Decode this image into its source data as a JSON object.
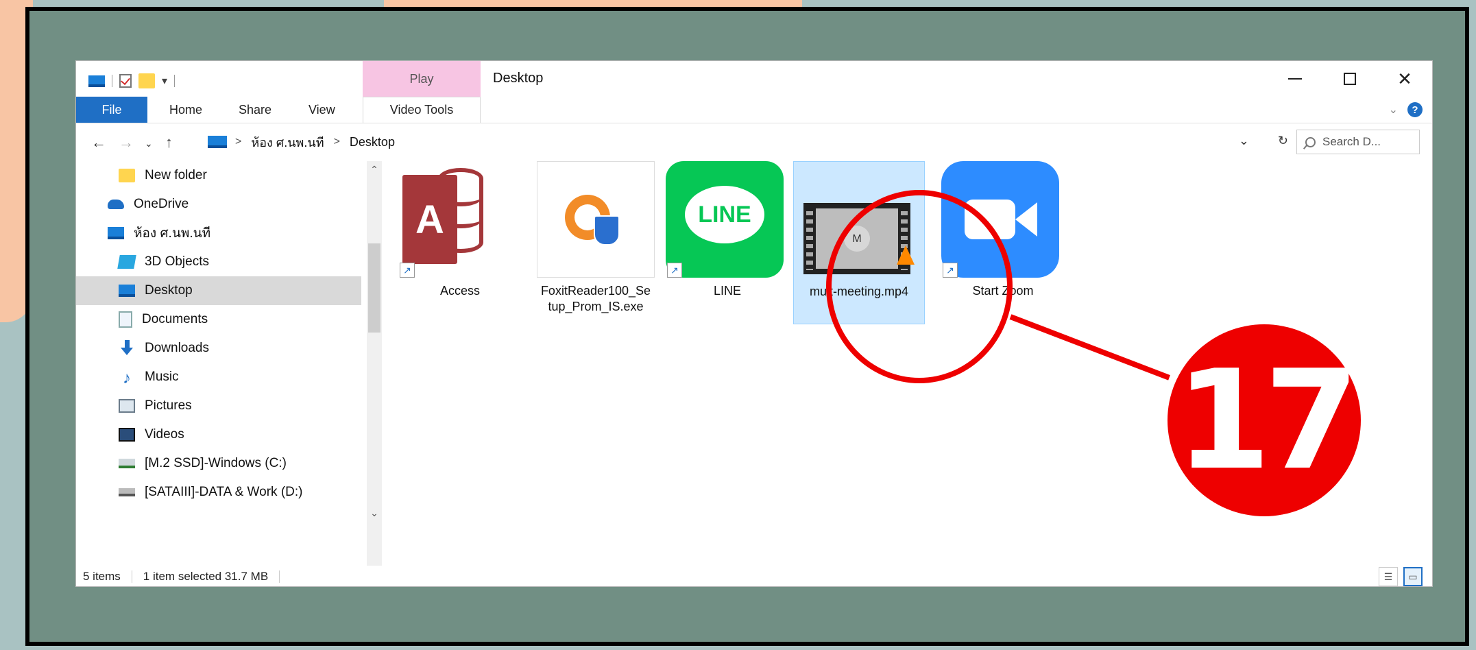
{
  "window": {
    "title": "Desktop",
    "contextual_tab_group": "Play",
    "ribbon_tabs": [
      "File",
      "Home",
      "Share",
      "View",
      "Video Tools"
    ]
  },
  "navigation": {
    "breadcrumbs": [
      "ห้อง ศ.นพ.นที",
      "Desktop"
    ],
    "search_placeholder": "Search D..."
  },
  "sidebar": {
    "items": [
      {
        "label": "New folder",
        "icon": "folder-icon"
      },
      {
        "label": "OneDrive",
        "icon": "onedrive-icon"
      },
      {
        "label": "ห้อง ศ.นพ.นที",
        "icon": "this-pc-icon"
      },
      {
        "label": "3D Objects",
        "icon": "3d-objects-icon"
      },
      {
        "label": "Desktop",
        "icon": "desktop-icon",
        "selected": true
      },
      {
        "label": "Documents",
        "icon": "documents-icon"
      },
      {
        "label": "Downloads",
        "icon": "downloads-icon"
      },
      {
        "label": "Music",
        "icon": "music-icon"
      },
      {
        "label": "Pictures",
        "icon": "pictures-icon"
      },
      {
        "label": "Videos",
        "icon": "videos-icon"
      },
      {
        "label": "[M.2 SSD]-Windows (C:)",
        "icon": "drive-c-icon"
      },
      {
        "label": "[SATAIII]-DATA & Work (D:)",
        "icon": "drive-d-icon"
      }
    ]
  },
  "files": [
    {
      "name": "Access",
      "icon": "access-icon",
      "shortcut": true
    },
    {
      "name": "FoxitReader100_Setup_Prom_IS.exe",
      "icon": "foxit-installer-icon"
    },
    {
      "name": "LINE",
      "icon": "line-icon",
      "shortcut": true
    },
    {
      "name": "muit-meeting.mp4",
      "icon": "video-file-icon",
      "selected": true,
      "thumb_letter": "M"
    },
    {
      "name": "Start Zoom",
      "icon": "zoom-icon",
      "shortcut": true
    }
  ],
  "status": {
    "item_count": "5 items",
    "selection": "1 item selected  31.7 MB"
  },
  "annotation": {
    "step_number": "17",
    "color": "#e00000"
  },
  "colors": {
    "frame": "#718f84",
    "accent": "#1f6fc5",
    "selection": "#cce8ff"
  }
}
